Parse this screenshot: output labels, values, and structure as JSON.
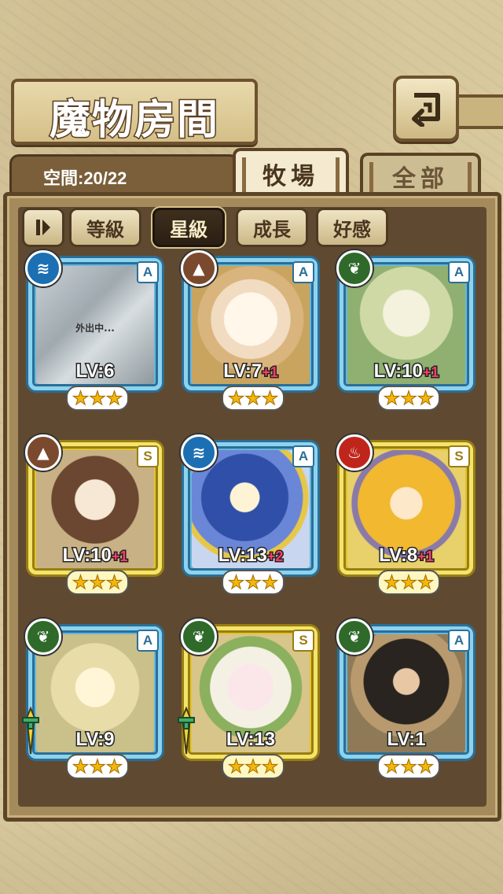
{
  "header": {
    "title": "魔物房間",
    "back_icon": "back-return-icon"
  },
  "space": {
    "label": "空間:20/22"
  },
  "tabs": [
    {
      "label": "牧場",
      "active": true
    },
    {
      "label": "全部",
      "active": false
    }
  ],
  "sort": {
    "toggle_icon": "sort-toggle-icon",
    "options": [
      {
        "label": "等級",
        "selected": false
      },
      {
        "label": "星級",
        "selected": true
      },
      {
        "label": "成長",
        "selected": false
      },
      {
        "label": "好感",
        "selected": false
      }
    ]
  },
  "monsters": [
    {
      "level": "LV:6",
      "bonus": "",
      "rank": "A",
      "element": "water",
      "stars": "★★★",
      "status": "外出中...",
      "frame": "blue",
      "art": "crystal",
      "weapon": false
    },
    {
      "level": "LV:7",
      "bonus": "+1",
      "rank": "A",
      "element": "earth",
      "stars": "★★★",
      "status": "",
      "frame": "blue",
      "art": "cream",
      "weapon": false
    },
    {
      "level": "LV:10",
      "bonus": "+1",
      "rank": "A",
      "element": "wind",
      "stars": "★★★",
      "status": "",
      "frame": "blue",
      "art": "fairy",
      "weapon": false
    },
    {
      "level": "LV:10",
      "bonus": "+1",
      "rank": "S",
      "element": "earth",
      "stars": "★★★",
      "status": "",
      "frame": "gold",
      "art": "brown",
      "weapon": false
    },
    {
      "level": "LV:13",
      "bonus": "+2",
      "rank": "A",
      "element": "water",
      "stars": "★★★",
      "status": "",
      "frame": "blue",
      "art": "blue",
      "weapon": false
    },
    {
      "level": "LV:8",
      "bonus": "+1",
      "rank": "S",
      "element": "fire",
      "stars": "★★★",
      "status": "",
      "frame": "gold",
      "art": "golden",
      "weapon": false
    },
    {
      "level": "LV:9",
      "bonus": "",
      "rank": "A",
      "element": "wind",
      "stars": "★★★",
      "status": "",
      "frame": "blue",
      "art": "light",
      "weapon": true
    },
    {
      "level": "LV:13",
      "bonus": "",
      "rank": "S",
      "element": "wind",
      "stars": "★★★",
      "status": "",
      "frame": "gold",
      "art": "pink",
      "weapon": true
    },
    {
      "level": "LV:1",
      "bonus": "",
      "rank": "A",
      "element": "wind",
      "stars": "★★★",
      "status": "",
      "frame": "blue",
      "art": "dark",
      "weapon": false
    }
  ]
}
